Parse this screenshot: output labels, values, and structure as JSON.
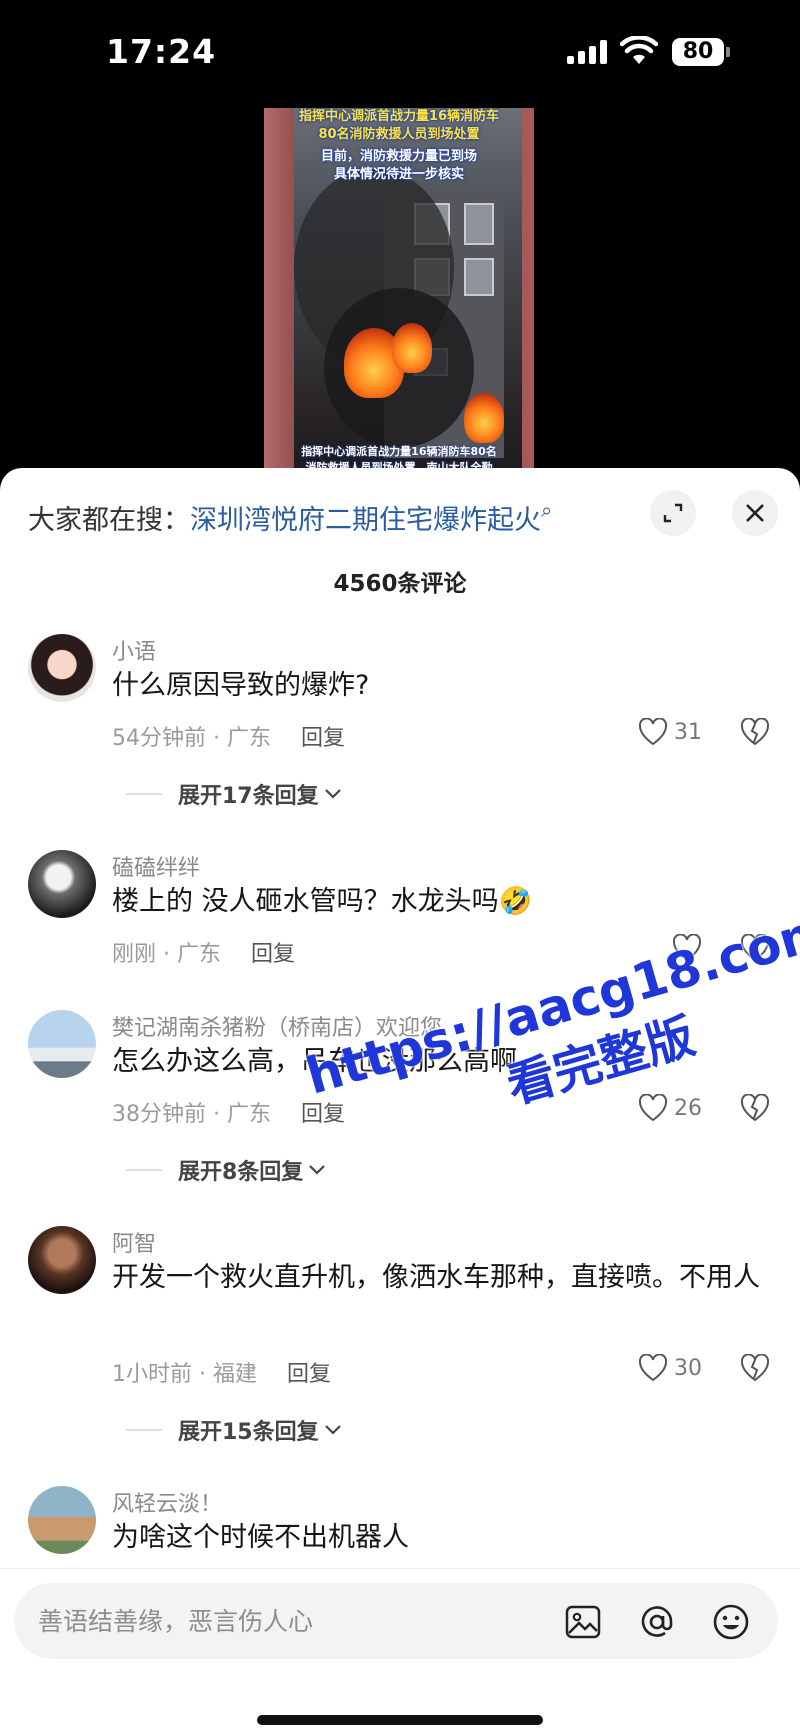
{
  "status_bar": {
    "time": "17:24",
    "battery": "80"
  },
  "video": {
    "caption_top_line1": "指挥中心调派首战力量16辆消防车",
    "caption_top_line2": "80名消防救援人员到场处置",
    "caption_top_line3": "目前，消防救援力量已到场",
    "caption_top_line4": "具体情况待进一步核实",
    "caption_bottom_line1": "指挥中心调派首战力量16辆消防车80名",
    "caption_bottom_line2": "消防救援人员到场处置，南山大队全勤"
  },
  "search": {
    "prefix": "大家都在搜：",
    "query": "深圳湾悦府二期住宅爆炸起火"
  },
  "comment_count": "4560条评论",
  "comments": [
    {
      "name": "小语",
      "text": "什么原因导致的爆炸?",
      "time": "54分钟前 · 广东",
      "reply": "回复",
      "likes": "31",
      "expand": "展开17条回复"
    },
    {
      "name": "磕磕绊绊",
      "text": "楼上的 没人砸水管吗？水龙头吗🤣",
      "time": "刚刚 · 广东",
      "reply": "回复",
      "likes": ""
    },
    {
      "name": "樊记湖南杀猪粉（桥南店）欢迎您",
      "text": "怎么办这么高，吊车也没那么高啊",
      "time": "38分钟前 · 广东",
      "reply": "回复",
      "likes": "26",
      "expand": "展开8条回复"
    },
    {
      "name": "阿智",
      "text": "开发一个救火直升机，像洒水车那种，直接喷。不用人",
      "time": "1小时前 · 福建",
      "reply": "回复",
      "likes": "30",
      "expand": "展开15条回复"
    },
    {
      "name": "风轻云淡！",
      "text": "为啥这个时候不出机器人"
    }
  ],
  "watermark": {
    "url": "https://aacg18.com",
    "slogan": "看完整版"
  },
  "input": {
    "placeholder": "善语结善缘，恶言伤人心"
  },
  "icons": [
    "search-icon",
    "expand-icon",
    "close-icon",
    "heart-icon",
    "broken-heart-icon",
    "chevron-down-icon",
    "image-icon",
    "at-icon",
    "emoji-icon"
  ]
}
